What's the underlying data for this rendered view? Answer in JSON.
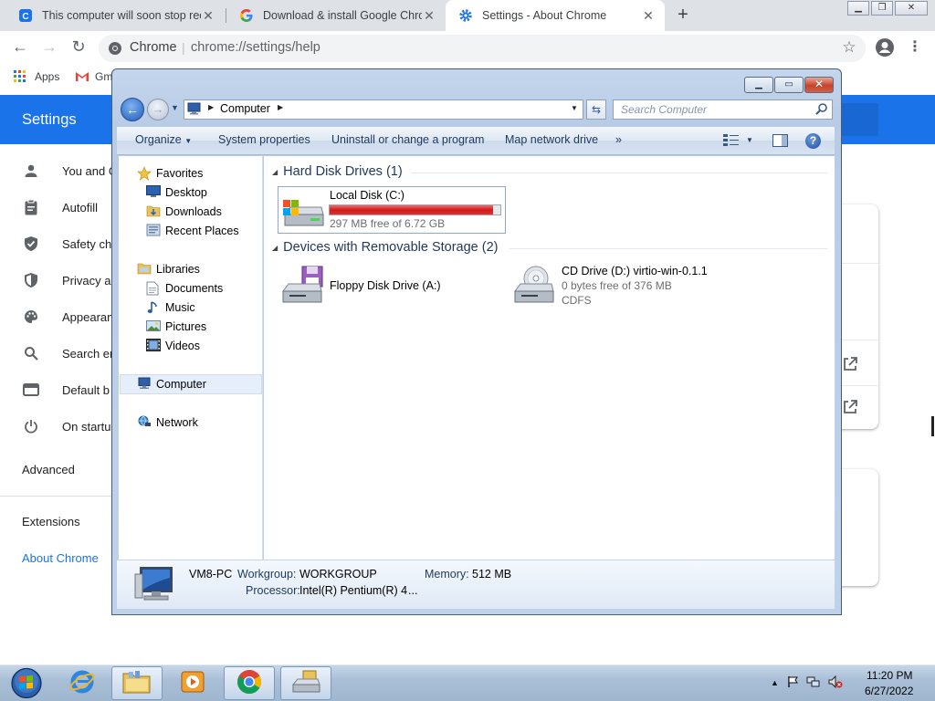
{
  "browser": {
    "tabs": [
      {
        "title": "This computer will soon stop rec",
        "favicon": "c-icon"
      },
      {
        "title": "Download & install Google Chro",
        "favicon": "google-g-icon"
      },
      {
        "title": "Settings - About Chrome",
        "favicon": "gear-icon"
      }
    ],
    "active_tab": 2,
    "new_tab": "+",
    "omnibox": {
      "chip": "Chrome",
      "separator": "|",
      "url": "chrome://settings/help"
    },
    "bookmarks": {
      "apps": "Apps",
      "gmail": "Gm"
    }
  },
  "settings": {
    "title": "Settings",
    "nav": [
      {
        "label": "You and G",
        "icon": "person-icon"
      },
      {
        "label": "Autofill",
        "icon": "clipboard-icon"
      },
      {
        "label": "Safety ch",
        "icon": "shield-check-icon"
      },
      {
        "label": "Privacy a",
        "icon": "shield-icon"
      },
      {
        "label": "Appearan",
        "icon": "palette-icon"
      },
      {
        "label": "Search er",
        "icon": "search-icon"
      },
      {
        "label": "Default b",
        "icon": "browser-icon"
      },
      {
        "label": "On startu",
        "icon": "power-icon"
      }
    ],
    "advanced": "Advanced",
    "extensions": "Extensions",
    "about": "About Chrome",
    "accent": "#1a73e8"
  },
  "explorer": {
    "address": {
      "location": "Computer"
    },
    "search_placeholder": "Search Computer",
    "commands": [
      "Organize",
      "System properties",
      "Uninstall or change a program",
      "Map network drive",
      "»"
    ],
    "nav": {
      "favorites": "Favorites",
      "favorites_items": [
        "Desktop",
        "Downloads",
        "Recent Places"
      ],
      "libraries": "Libraries",
      "libraries_items": [
        "Documents",
        "Music",
        "Pictures",
        "Videos"
      ],
      "computer": "Computer",
      "network": "Network"
    },
    "groups": {
      "hdd": "Hard Disk Drives (1)",
      "removable": "Devices with Removable Storage (2)"
    },
    "drives": {
      "c": {
        "name": "Local Disk (C:)",
        "free_text": "297 MB free of 6.72 GB",
        "used_fraction": 0.957
      },
      "floppy": {
        "name": "Floppy Disk Drive (A:)"
      },
      "cd": {
        "name": "CD Drive (D:) virtio-win-0.1.1",
        "free_text": "0 bytes free of 376 MB",
        "fs": "CDFS"
      }
    },
    "details": {
      "pc_name": "VM8-PC",
      "workgroup_label": "Workgroup:",
      "workgroup": "WORKGROUP",
      "memory_label": "Memory:",
      "memory": "512 MB",
      "processor_label": "Processor:",
      "processor": "Intel(R) Pentium(R) 4",
      "ellipsis": "..."
    }
  },
  "taskbar": {
    "clock_time": "11:20 PM",
    "clock_date": "6/27/2022"
  }
}
